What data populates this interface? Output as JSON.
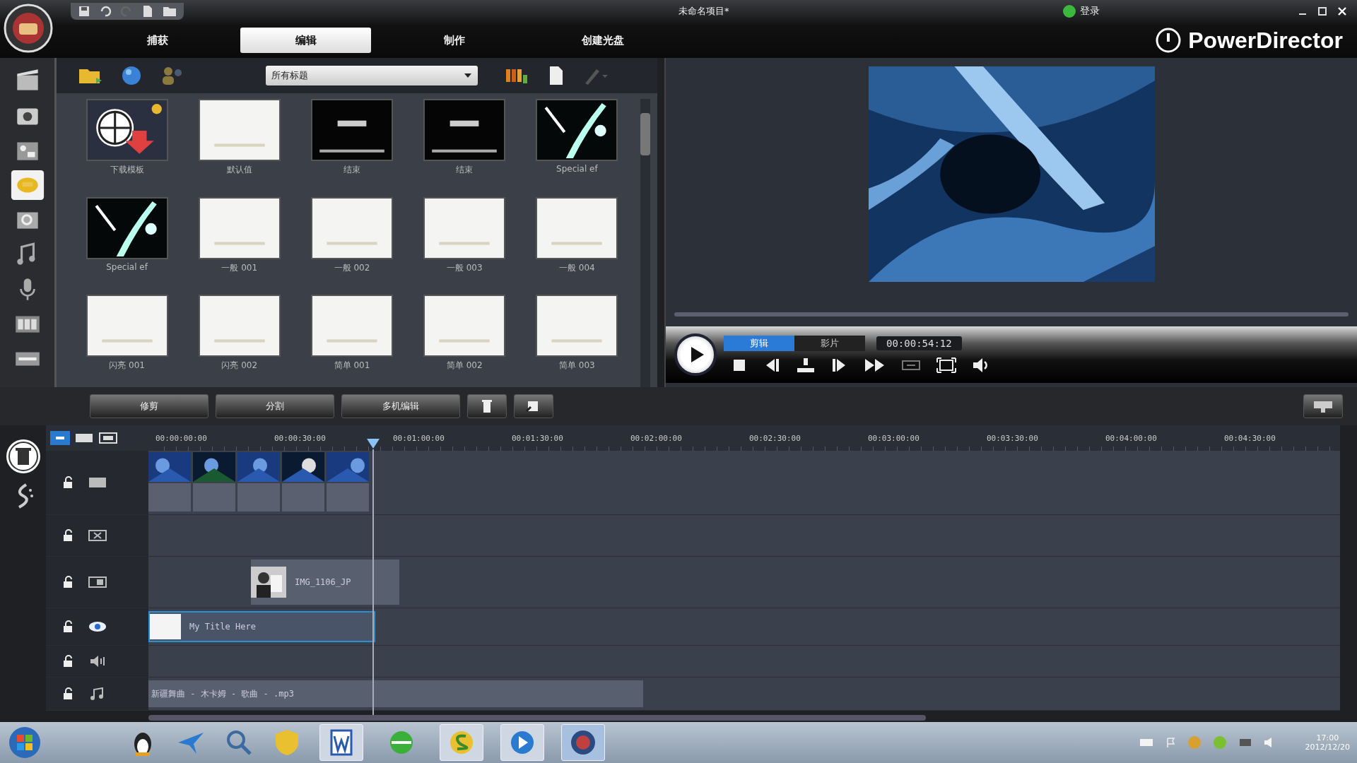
{
  "window": {
    "title": "未命名项目*",
    "login": "登录",
    "brand": "PowerDirector"
  },
  "tabs": [
    {
      "label": "捕获",
      "selected": false
    },
    {
      "label": "编辑",
      "selected": true
    },
    {
      "label": "制作",
      "selected": false
    },
    {
      "label": "创建光盘",
      "selected": false
    }
  ],
  "rooms": [
    {
      "kind": "media",
      "selected": false
    },
    {
      "kind": "capture",
      "selected": false
    },
    {
      "kind": "effect",
      "selected": false
    },
    {
      "kind": "title",
      "selected": true
    },
    {
      "kind": "pip",
      "selected": false
    },
    {
      "kind": "audio",
      "selected": false
    },
    {
      "kind": "voice",
      "selected": false
    },
    {
      "kind": "chapter",
      "selected": false
    },
    {
      "kind": "subtitle",
      "selected": false
    }
  ],
  "library": {
    "filter": "所有标题",
    "items": [
      {
        "label": "下载模板",
        "kind": "download"
      },
      {
        "label": "默认值",
        "kind": "blank"
      },
      {
        "label": "结束",
        "kind": "dark"
      },
      {
        "label": "结束",
        "kind": "dark"
      },
      {
        "label": "Special ef",
        "kind": "special"
      },
      {
        "label": "Special ef",
        "kind": "special"
      },
      {
        "label": "一般 001",
        "kind": "blank"
      },
      {
        "label": "一般 002",
        "kind": "blank"
      },
      {
        "label": "一般 003",
        "kind": "blank"
      },
      {
        "label": "一般 004",
        "kind": "blank"
      },
      {
        "label": "闪亮 001",
        "kind": "blank"
      },
      {
        "label": "闪亮 002",
        "kind": "blank"
      },
      {
        "label": "简单 001",
        "kind": "blank"
      },
      {
        "label": "简单 002",
        "kind": "blank"
      },
      {
        "label": "简单 003",
        "kind": "blank"
      }
    ]
  },
  "preview": {
    "modes": [
      {
        "label": "剪辑",
        "selected": true
      },
      {
        "label": "影片",
        "selected": false
      }
    ],
    "timecode": "00:00:54:12"
  },
  "edit_buttons": [
    "修剪",
    "分割",
    "多机编辑"
  ],
  "timeline": {
    "ruler": [
      "00:00:00:00",
      "00:00:30:00",
      "00:01:00:00",
      "00:01:30:00",
      "00:02:00:00",
      "00:02:30:00",
      "00:03:00:00",
      "00:03:30:00",
      "00:04:00:00",
      "00:04:30:00"
    ],
    "tracks": [
      {
        "kind": "video"
      },
      {
        "kind": "effect"
      },
      {
        "kind": "pip",
        "clip": "IMG_1106_JP"
      },
      {
        "kind": "title",
        "clip": "My Title Here"
      },
      {
        "kind": "voice"
      },
      {
        "kind": "music",
        "clip": "新疆舞曲 - 木卡姆 - 歌曲 - .mp3"
      }
    ]
  },
  "taskbar": {
    "time": "17:00",
    "date": "2012/12/20"
  }
}
